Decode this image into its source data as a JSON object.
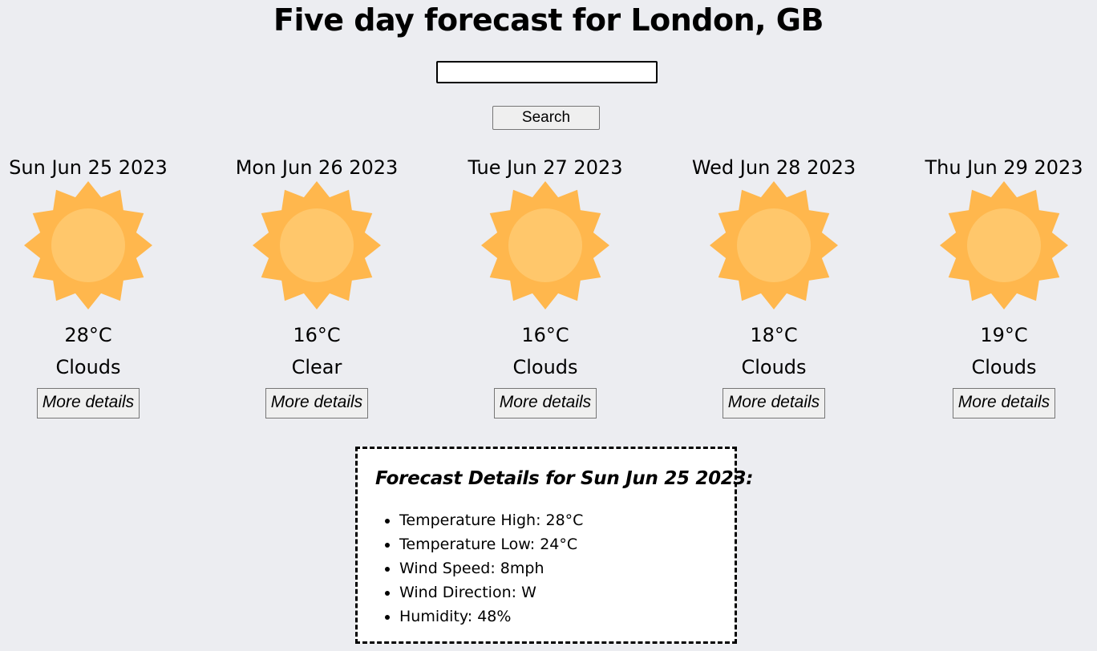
{
  "page": {
    "title": "Five day forecast for London, GB"
  },
  "search": {
    "value": "",
    "placeholder": "",
    "button_label": "Search"
  },
  "colors": {
    "background": "#ecedf1",
    "sun_outer": "#ffb74d",
    "sun_inner": "#ffc76b",
    "panel_background": "#ffffff"
  },
  "forecast": [
    {
      "date": "Sun Jun 25 2023",
      "temp": "28°C",
      "condition": "Clouds",
      "icon": "sun-icon",
      "details_label": "More details"
    },
    {
      "date": "Mon Jun 26 2023",
      "temp": "16°C",
      "condition": "Clear",
      "icon": "sun-icon",
      "details_label": "More details"
    },
    {
      "date": "Tue Jun 27 2023",
      "temp": "16°C",
      "condition": "Clouds",
      "icon": "sun-icon",
      "details_label": "More details"
    },
    {
      "date": "Wed Jun 28 2023",
      "temp": "18°C",
      "condition": "Clouds",
      "icon": "sun-icon",
      "details_label": "More details"
    },
    {
      "date": "Thu Jun 29 2023",
      "temp": "19°C",
      "condition": "Clouds",
      "icon": "sun-icon",
      "details_label": "More details"
    }
  ],
  "details": {
    "title": "Forecast Details for Sun Jun 25 2023:",
    "items": [
      "Temperature High: 28°C",
      "Temperature Low: 24°C",
      "Wind Speed: 8mph",
      "Wind Direction: W",
      "Humidity: 48%"
    ]
  }
}
